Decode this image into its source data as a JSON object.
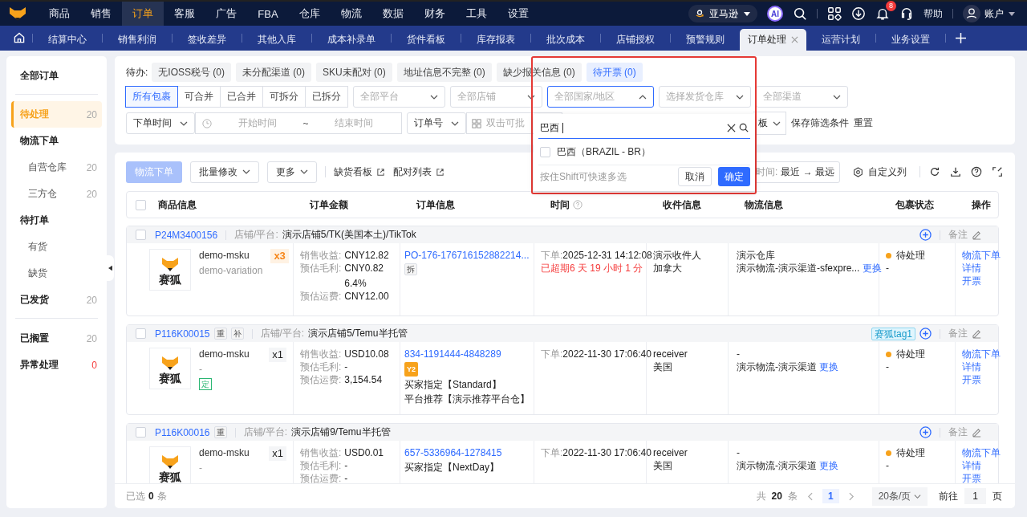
{
  "nav": {
    "menu": [
      {
        "label": "商品",
        "selected": false
      },
      {
        "label": "销售",
        "selected": false
      },
      {
        "label": "订单",
        "selected": true
      },
      {
        "label": "客服",
        "selected": false
      },
      {
        "label": "广告",
        "selected": false
      },
      {
        "label": "FBA",
        "selected": false
      },
      {
        "label": "仓库",
        "selected": false
      },
      {
        "label": "物流",
        "selected": false
      },
      {
        "label": "数据",
        "selected": false
      },
      {
        "label": "财务",
        "selected": false
      },
      {
        "label": "工具",
        "selected": false
      },
      {
        "label": "设置",
        "selected": false
      }
    ],
    "marketplace": "亚马逊",
    "ai": "AI",
    "notifications": "8",
    "help": "帮助",
    "account": "账户"
  },
  "tabs": [
    {
      "label": "结算中心",
      "selected": false
    },
    {
      "label": "销售利润",
      "selected": false
    },
    {
      "label": "签收差异",
      "selected": false
    },
    {
      "label": "其他入库",
      "selected": false
    },
    {
      "label": "成本补录单",
      "selected": false
    },
    {
      "label": "货件看板",
      "selected": false
    },
    {
      "label": "库存报表",
      "selected": false
    },
    {
      "label": "批次成本",
      "selected": false
    },
    {
      "label": "店铺授权",
      "selected": false
    },
    {
      "label": "预警规则",
      "selected": false
    },
    {
      "label": "订单处理",
      "selected": true
    },
    {
      "label": "运营计划",
      "selected": false
    },
    {
      "label": "业务设置",
      "selected": false
    }
  ],
  "sidebar": {
    "sections": [
      {
        "items": [
          {
            "label": "全部订单",
            "selected": false
          }
        ]
      },
      {
        "items": [
          {
            "label": "待处理",
            "count": "20",
            "selected": true,
            "alert": false
          },
          {
            "label": "物流下单",
            "selected": false,
            "children": [
              {
                "label": "自营仓库",
                "count": "20",
                "selected": false
              },
              {
                "label": "三方仓",
                "count": "20",
                "selected": false
              }
            ]
          },
          {
            "label": "待打单",
            "selected": false,
            "children": [
              {
                "label": "有货",
                "selected": false
              },
              {
                "label": "缺货",
                "selected": false
              }
            ]
          },
          {
            "label": "已发货",
            "count": "20",
            "selected": false,
            "alert": false
          }
        ]
      },
      {
        "items": [
          {
            "label": "已搁置",
            "count": "20",
            "selected": false,
            "alert": false
          },
          {
            "label": "异常处理",
            "count": "0",
            "selected": false,
            "alert": true
          }
        ]
      }
    ]
  },
  "filters": {
    "todo_label": "待办:",
    "todos": [
      {
        "label": "无IOSS税号 (0)",
        "selected": false
      },
      {
        "label": "未分配渠道 (0)",
        "selected": false
      },
      {
        "label": "SKU未配对 (0)",
        "selected": false
      },
      {
        "label": "地址信息不完整 (0)",
        "selected": false
      },
      {
        "label": "缺少报关信息 (0)",
        "selected": false
      },
      {
        "label": "待开票 (0)",
        "selected": true
      }
    ],
    "package_types": [
      {
        "label": "所有包裹",
        "selected": true
      },
      {
        "label": "可合并",
        "selected": false
      },
      {
        "label": "已合并",
        "selected": false
      },
      {
        "label": "可拆分",
        "selected": false
      },
      {
        "label": "已拆分",
        "selected": false
      }
    ],
    "selects": [
      {
        "placeholder": "全部平台",
        "open": false
      },
      {
        "placeholder": "全部店铺",
        "open": false
      },
      {
        "placeholder": "全部国家/地区",
        "open": true
      },
      {
        "placeholder": "选择发货仓库",
        "open": false
      },
      {
        "placeholder": "全部渠道",
        "open": false
      }
    ],
    "time_select": "下单时间",
    "start_placeholder": "开始时间",
    "range_separator": "~",
    "end_placeholder": "结束时间",
    "order_no_select": "订单号",
    "batch_placeholder": "双击可批",
    "template_select": "板",
    "save_filter": "保存筛选条件",
    "reset": "重置"
  },
  "country_dropdown": {
    "search_value": "巴西",
    "options": [
      {
        "label": "巴西（BRAZIL - BR）",
        "checked": false
      }
    ],
    "hint": "按住Shift可快速多选",
    "cancel": "取消",
    "confirm": "确定"
  },
  "toolbar": {
    "primary": {
      "label": "物流下单",
      "disabled": true
    },
    "batch_edit": "批量修改",
    "more": "更多",
    "links": [
      "缺货看板",
      "配对列表"
    ],
    "sort_label": "时间:",
    "sort_value": "最近 → 最远",
    "custom_columns": "自定义列"
  },
  "table": {
    "all_checked": false,
    "columns": [
      {
        "label": "商品信息",
        "help": false
      },
      {
        "label": "订单金额",
        "help": false
      },
      {
        "label": "订单信息",
        "help": false
      },
      {
        "label": "时间",
        "help": true
      },
      {
        "label": "收件信息",
        "help": false
      },
      {
        "label": "物流信息",
        "help": false
      },
      {
        "label": "包裹状态",
        "help": false
      },
      {
        "label": "操作",
        "help": false
      }
    ],
    "orders": [
      {
        "checked": false,
        "id": "P24M3400156",
        "store_label": "店铺/平台:",
        "store": "演示店铺5/TK(美国本土)/TikTok",
        "note": "备注",
        "image_text": "赛狐",
        "msku": "demo-msku",
        "variation": "demo-variation",
        "qty": "x3",
        "qty_highlight": true,
        "amounts": [
          {
            "label": "销售收益:",
            "values": [
              "CNY12.82"
            ]
          },
          {
            "label": "预估毛利:",
            "values": [
              "CNY0.82",
              "6.4%"
            ]
          },
          {
            "label": "预估运费:",
            "values": [
              "CNY12.00"
            ]
          }
        ],
        "order_no": "PO-176-176716152882214...",
        "order_badge": "拆",
        "time_label": "下单:",
        "time": "2025-12-31 14:12:08",
        "overdue": "已超期6 天 19 小时 1 分",
        "receiver": [
          "演示收件人",
          "加拿大"
        ],
        "warehouse": "演示仓库",
        "channel": "演示物流-演示渠道-sfexpre...",
        "change": "更换",
        "status": "待处理",
        "color": "#f7a21b",
        "status_sub": "-",
        "actions": [
          "物流下单",
          "详情",
          "开票"
        ]
      },
      {
        "checked": false,
        "id": "P116K00015",
        "badges": [
          "重",
          "补"
        ],
        "store_label": "店铺/平台:",
        "store": "演示店铺5/Temu半托管",
        "tag": "赛狐tag1",
        "note": "备注",
        "image_text": "赛狐",
        "msku": "demo-msku",
        "variation": "-",
        "product_tag": "定",
        "qty": "x1",
        "qty_highlight": false,
        "amounts": [
          {
            "label": "销售收益:",
            "values": [
              "USD10.08"
            ]
          },
          {
            "label": "预估毛利:",
            "values": [
              "-"
            ]
          },
          {
            "label": "预估运费:",
            "values": [
              "3,154.54"
            ]
          }
        ],
        "order_no": "834-1191444-4848289",
        "order_icon": "Y2",
        "order_lines": [
          "买家指定【Standard】",
          "平台推荐【演示推荐平台仓】"
        ],
        "time_label": "下单:",
        "time": "2022-11-30 17:06:40",
        "receiver": [
          "receiver",
          "美国"
        ],
        "warehouse": "-",
        "channel": "演示物流-演示渠道",
        "change": "更换",
        "status": "待处理",
        "color": "#f7a21b",
        "status_sub": "-",
        "actions": [
          "物流下单",
          "详情",
          "开票"
        ]
      },
      {
        "checked": false,
        "id": "P116K00016",
        "badges": [
          "重"
        ],
        "store_label": "店铺/平台:",
        "store": "演示店铺9/Temu半托管",
        "note": "备注",
        "image_text": "赛狐",
        "msku": "demo-msku",
        "variation": "-",
        "qty": "x1",
        "qty_highlight": false,
        "amounts": [
          {
            "label": "销售收益:",
            "values": [
              "USD0.01"
            ]
          },
          {
            "label": "预估毛利:",
            "values": [
              "-"
            ]
          },
          {
            "label": "预估运费:",
            "values": [
              "-"
            ]
          }
        ],
        "order_no": "657-5336964-1278415",
        "order_lines": [
          "买家指定【NextDay】"
        ],
        "time_label": "下单:",
        "time": "2022-11-30 17:06:40",
        "receiver": [
          "receiver",
          "美国"
        ],
        "warehouse": "-",
        "channel": "演示物流-演示渠道",
        "change": "更换",
        "status": "待处理",
        "color": "#f7a21b",
        "status_sub": "-",
        "actions": [
          "物流下单",
          "详情",
          "开票"
        ]
      }
    ]
  },
  "footer": {
    "selected_label": "已选",
    "selected_count": "0",
    "selected_unit": "条",
    "total_label": "共",
    "total": "20",
    "total_unit": "条",
    "page": "1",
    "page_size": "20条/页",
    "goto_label": "前往",
    "goto_value": "1",
    "goto_unit": "页"
  }
}
